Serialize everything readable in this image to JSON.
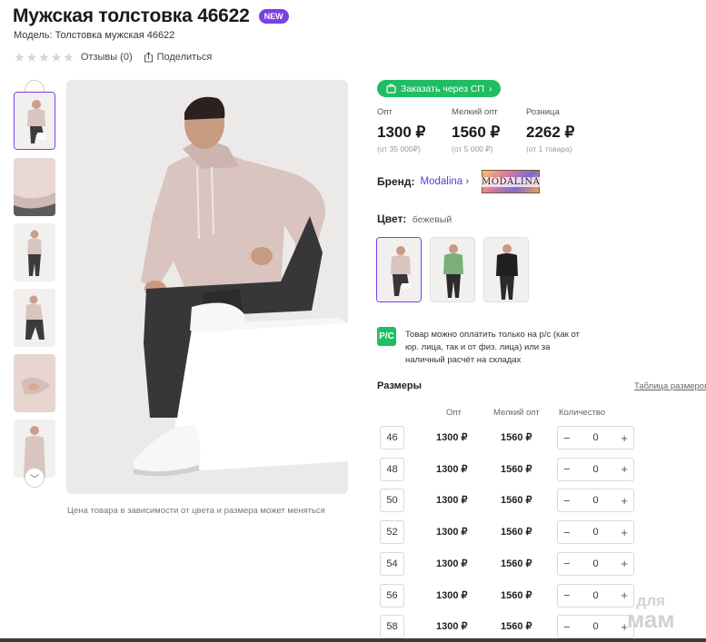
{
  "product": {
    "title": "Мужская толстовка 46622",
    "badge": "NEW",
    "model": "Модель: Толстовка мужская 46622",
    "reviews": "Отзывы (0)",
    "share": "Поделиться",
    "rating_stars": 0,
    "price_note": "Цена товара в зависимости от цвета и размера может меняться"
  },
  "order_button": "Заказать через СП",
  "prices": [
    {
      "label": "Опт",
      "value": "1300 ₽",
      "sub": "(от 35 000₽)"
    },
    {
      "label": "Мелкий опт",
      "value": "1560 ₽",
      "sub": "(от 5 000 ₽)"
    },
    {
      "label": "Розница",
      "value": "2262 ₽",
      "sub": "(от 1 товара)"
    }
  ],
  "brand": {
    "label": "Бренд:",
    "name": "Modalina",
    "logo_text": "MODALINA"
  },
  "color": {
    "label": "Цвет:",
    "value": "бежевый",
    "swatches": [
      "beige",
      "green",
      "black"
    ]
  },
  "payment": {
    "icon_text": "Р/С",
    "text": "Товар можно оплатить только на р/с (как от юр. лица, так и от физ. лица) или за наличный расчёт на складах"
  },
  "sizes": {
    "title": "Размеры",
    "table_link": "Таблица размеров",
    "headers": {
      "opt": "Опт",
      "small_opt": "Мелкий опт",
      "qty": "Количество"
    },
    "rows": [
      {
        "size": "46",
        "opt": "1300 ₽",
        "small": "1560 ₽",
        "qty": "0"
      },
      {
        "size": "48",
        "opt": "1300 ₽",
        "small": "1560 ₽",
        "qty": "0"
      },
      {
        "size": "50",
        "opt": "1300 ₽",
        "small": "1560 ₽",
        "qty": "0"
      },
      {
        "size": "52",
        "opt": "1300 ₽",
        "small": "1560 ₽",
        "qty": "0"
      },
      {
        "size": "54",
        "opt": "1300 ₽",
        "small": "1560 ₽",
        "qty": "0"
      },
      {
        "size": "56",
        "opt": "1300 ₽",
        "small": "1560 ₽",
        "qty": "0"
      },
      {
        "size": "58",
        "opt": "1300 ₽",
        "small": "1560 ₽",
        "qty": "0"
      }
    ]
  },
  "watermark": {
    "line1": "для",
    "line2": "мам"
  },
  "colors": {
    "accent": "#7b3fe4",
    "green": "#1fbe62",
    "hoodie": "#d9c4c0"
  }
}
